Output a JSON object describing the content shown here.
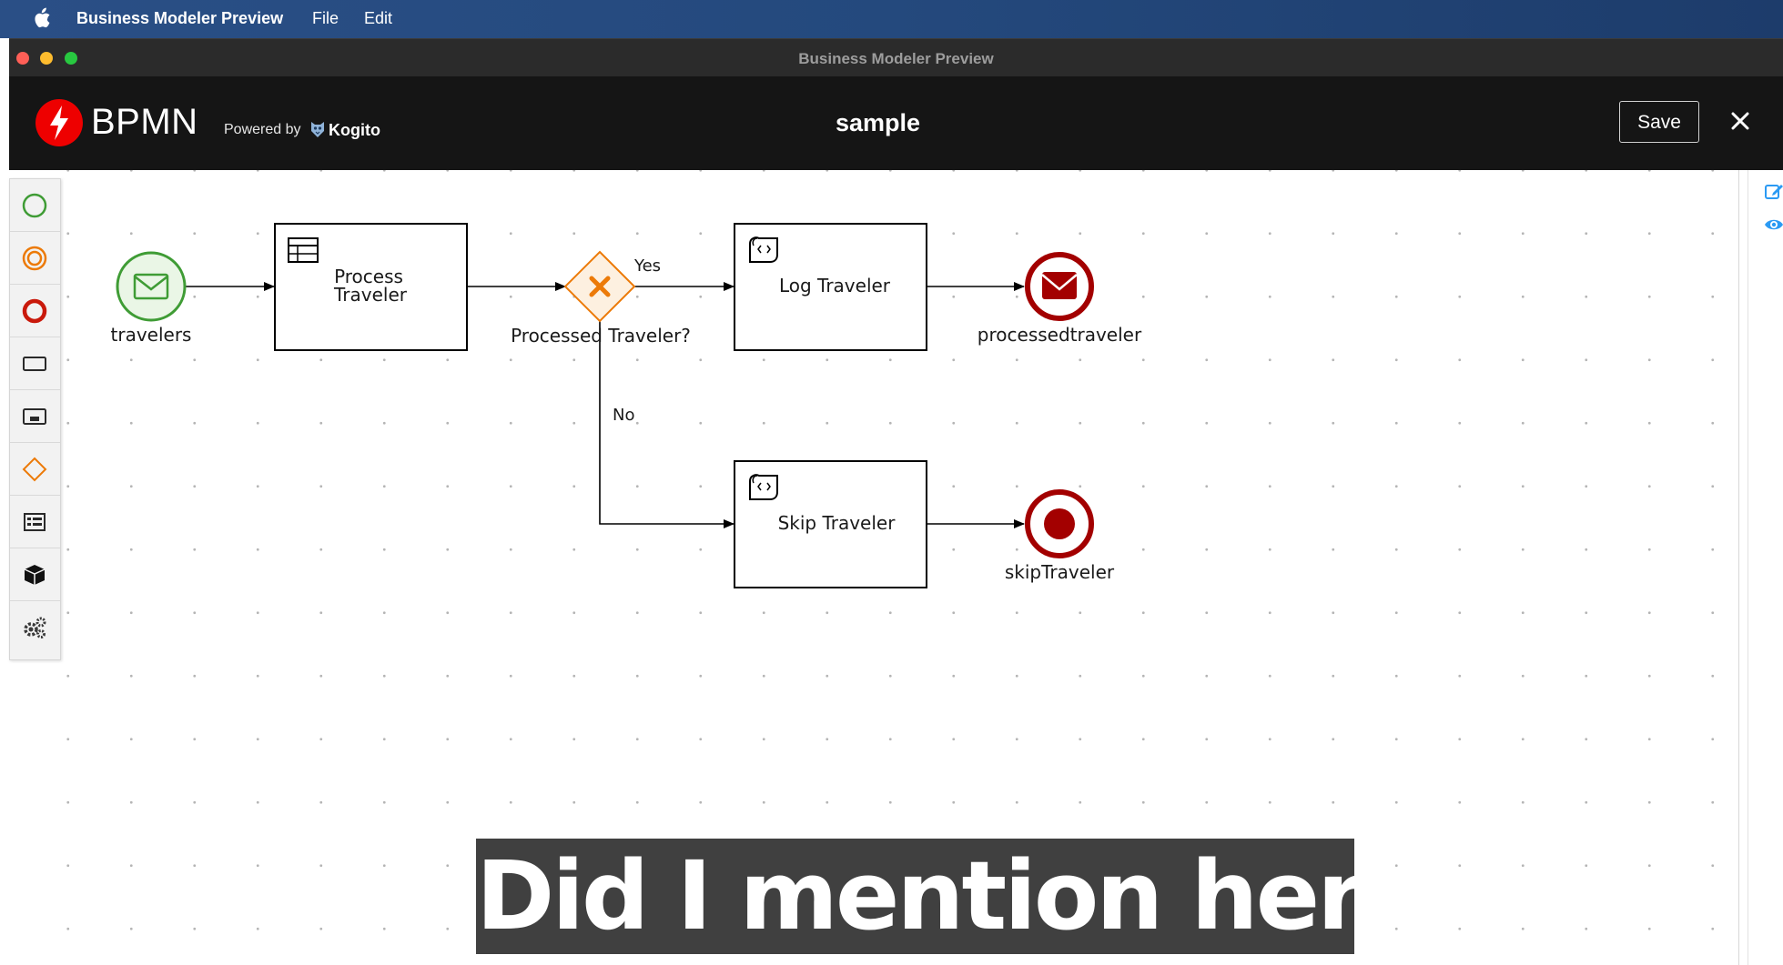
{
  "menubar": {
    "app_name": "Business Modeler Preview",
    "menus": [
      "File",
      "Edit"
    ]
  },
  "window": {
    "title": "Business Modeler Preview"
  },
  "header": {
    "logo_text": "BPMN",
    "powered_by": "Powered by",
    "kogito": "Kogito",
    "document_name": "sample",
    "save_label": "Save"
  },
  "palette": {
    "items": [
      "start-event",
      "intermediate-event",
      "end-event",
      "task",
      "subprocess",
      "gateway",
      "data-object",
      "custom-task",
      "settings"
    ]
  },
  "diagram": {
    "nodes": {
      "travelers": "travelers",
      "process_traveler_line1": "Process",
      "process_traveler_line2": "Traveler",
      "gateway": "Processed Traveler?",
      "log_traveler": "Log Traveler",
      "processed_end": "processedtraveler",
      "skip_traveler": "Skip Traveler",
      "skip_end": "skipTraveler"
    },
    "edges": {
      "yes": "Yes",
      "no": "No"
    }
  },
  "caption": "Did I mention here?",
  "colors": {
    "start_event": "#3f9c35",
    "end_event": "#a30000",
    "gateway": "#ec7a08",
    "header_bg": "#151515",
    "logo_red": "#ee0000"
  }
}
